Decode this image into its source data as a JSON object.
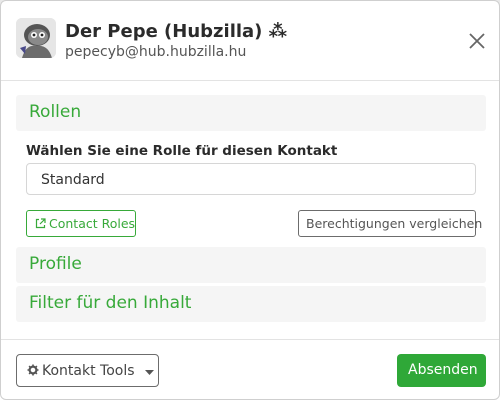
{
  "header": {
    "title": "Der Pepe (Hubzilla) ⁂",
    "subtitle": "pepecyb@hub.hubzilla.hu"
  },
  "sections": {
    "roles": {
      "title": "Rollen"
    },
    "profile": {
      "title": "Profile"
    },
    "filter": {
      "title": "Filter für den Inhalt"
    }
  },
  "role_select": {
    "label": "Wählen Sie eine Rolle für diesen Kontakt",
    "value": "Standard"
  },
  "buttons": {
    "contact_roles": "Contact Roles",
    "compare_permissions": "Berechtigungen vergleichen",
    "contact_tools": "Kontakt Tools",
    "submit": "Absenden"
  },
  "colors": {
    "accent_green": "#37a939",
    "submit_green": "#2fa838"
  },
  "icons": {
    "close": "close-icon",
    "external_link": "external-link-icon",
    "gear": "gear-icon",
    "caret": "caret-down-icon"
  }
}
